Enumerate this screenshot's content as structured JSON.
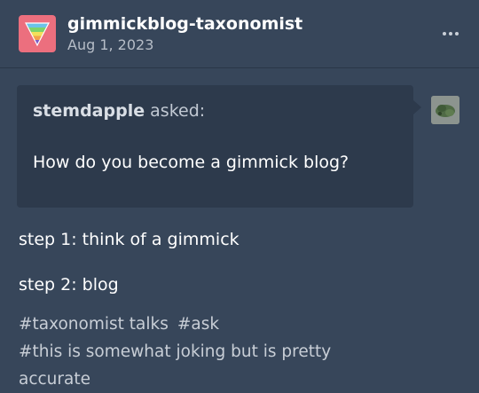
{
  "post": {
    "blog_name": "gimmickblog-taxonomist",
    "date": "Aug 1, 2023",
    "more_icon": "ellipsis-icon",
    "avatar_icon": "triangle-logo-icon"
  },
  "ask": {
    "asker": "stemdapple",
    "asked_label": "asked:",
    "question": "How do you become a gimmick blog?",
    "asker_avatar_icon": "asker-avatar-image"
  },
  "body": {
    "lines": [
      "step 1: think of a gimmick",
      "step 2: blog"
    ]
  },
  "tags": [
    "#taxonomist talks",
    "#ask",
    "#this is somewhat joking but is pretty accurate"
  ],
  "colors": {
    "background": "#37465a",
    "ask_box": "#2d3a4c",
    "avatar_bg": "#ec6f7e",
    "secondary_text": "#b6bdc7"
  }
}
